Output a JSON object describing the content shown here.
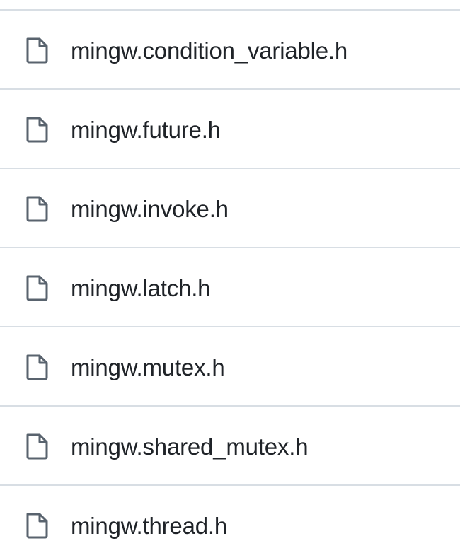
{
  "files": [
    {
      "name": "mingw.condition_variable.h",
      "icon": "file-icon"
    },
    {
      "name": "mingw.future.h",
      "icon": "file-icon"
    },
    {
      "name": "mingw.invoke.h",
      "icon": "file-icon"
    },
    {
      "name": "mingw.latch.h",
      "icon": "file-icon"
    },
    {
      "name": "mingw.mutex.h",
      "icon": "file-icon"
    },
    {
      "name": "mingw.shared_mutex.h",
      "icon": "file-icon"
    },
    {
      "name": "mingw.thread.h",
      "icon": "file-icon"
    }
  ],
  "colors": {
    "text": "#1f2328",
    "divider": "#d8dee4",
    "icon": "#59636e"
  }
}
